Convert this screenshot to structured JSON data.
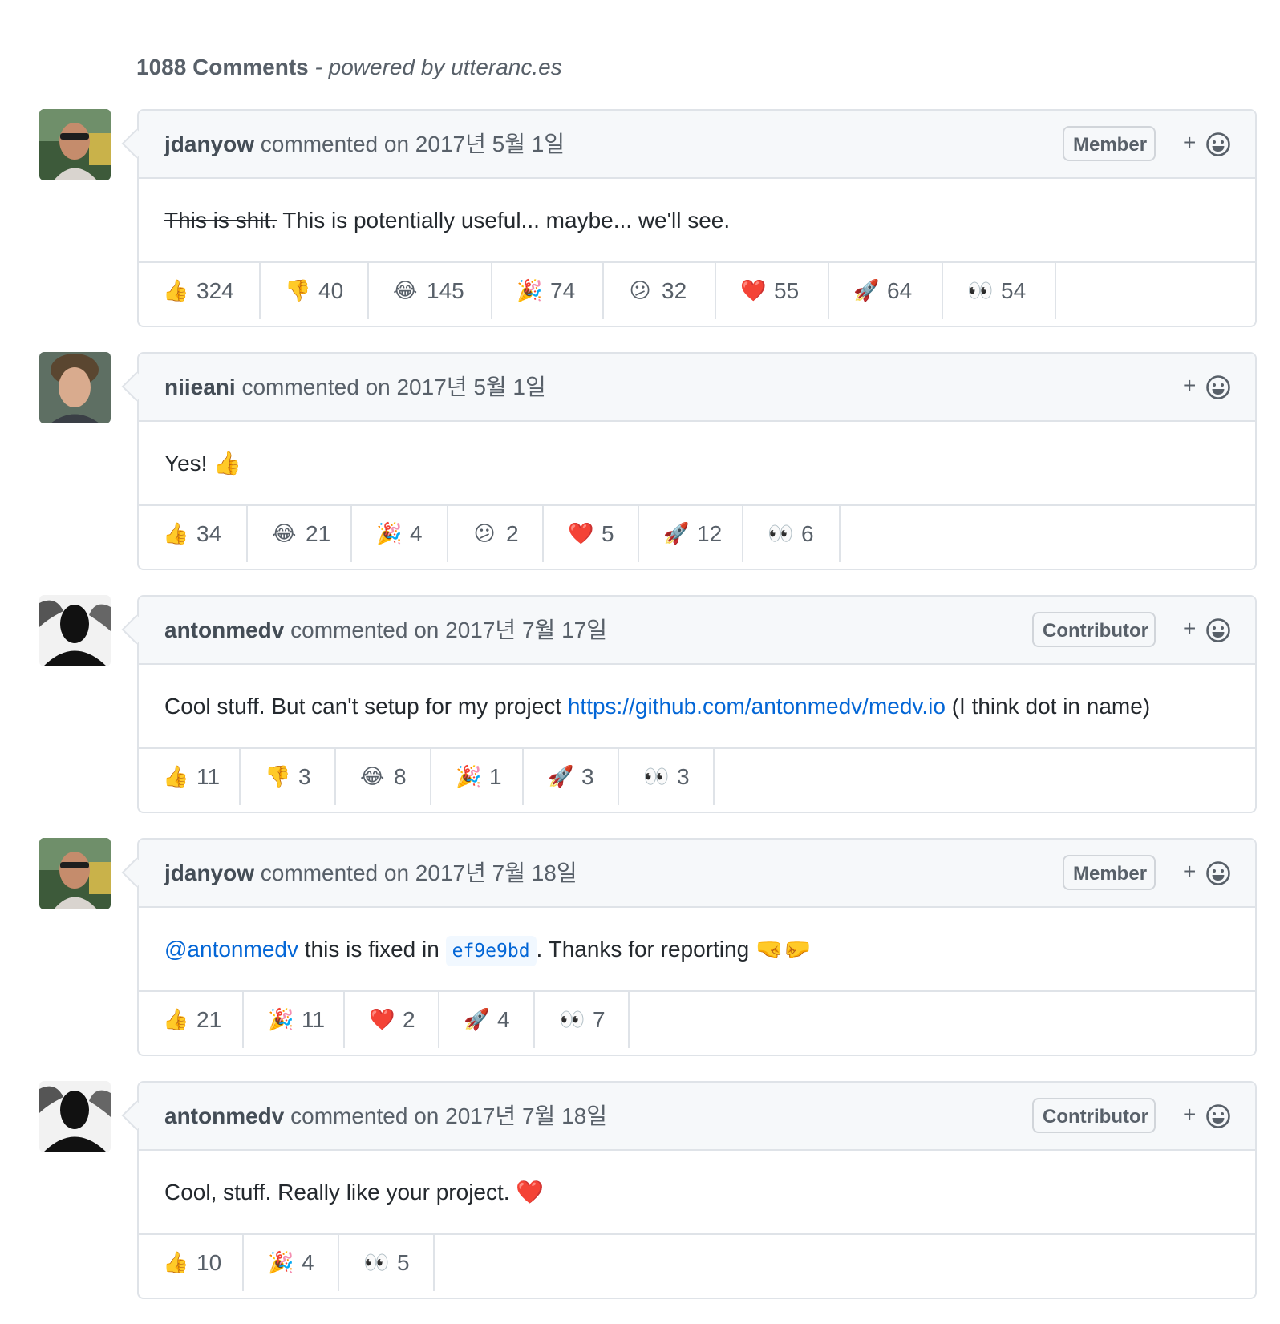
{
  "header": {
    "count_label": "1088 Comments",
    "powered_label": " - powered by utteranc.es"
  },
  "comments": [
    {
      "author": "jdanyow",
      "commented_label": "commented",
      "date_label": "on 2017년 5월 1일",
      "role": "Member",
      "avatar_icon": "avatar-jdanyow",
      "body": {
        "strike": "This is shit.",
        "text": " This is potentially useful... maybe... we'll see."
      },
      "reactions": [
        {
          "icon": "thumbs-up-icon",
          "glyph": "👍",
          "count": "324"
        },
        {
          "icon": "thumbs-down-icon",
          "glyph": "👎",
          "count": "40"
        },
        {
          "icon": "laugh-icon",
          "glyph": "😂",
          "count": "145"
        },
        {
          "icon": "hooray-icon",
          "glyph": "🎉",
          "count": "74"
        },
        {
          "icon": "confused-icon",
          "glyph": "😕",
          "count": "32"
        },
        {
          "icon": "heart-icon",
          "glyph": "❤️",
          "count": "55"
        },
        {
          "icon": "rocket-icon",
          "glyph": "🚀",
          "count": "64"
        },
        {
          "icon": "eyes-icon",
          "glyph": "👀",
          "count": "54"
        }
      ]
    },
    {
      "author": "niieani",
      "commented_label": "commented",
      "date_label": "on 2017년 5월 1일",
      "role": "",
      "avatar_icon": "avatar-niieani",
      "body": {
        "text": "Yes! 👍"
      },
      "reactions": [
        {
          "icon": "thumbs-up-icon",
          "glyph": "👍",
          "count": "34"
        },
        {
          "icon": "laugh-icon",
          "glyph": "😂",
          "count": "21"
        },
        {
          "icon": "hooray-icon",
          "glyph": "🎉",
          "count": "4"
        },
        {
          "icon": "confused-icon",
          "glyph": "😕",
          "count": "2"
        },
        {
          "icon": "heart-icon",
          "glyph": "❤️",
          "count": "5"
        },
        {
          "icon": "rocket-icon",
          "glyph": "🚀",
          "count": "12"
        },
        {
          "icon": "eyes-icon",
          "glyph": "👀",
          "count": "6"
        }
      ]
    },
    {
      "author": "antonmedv",
      "commented_label": "commented",
      "date_label": "on 2017년 7월 17일",
      "role": "Contributor",
      "avatar_icon": "avatar-antonmedv",
      "body": {
        "text": "Cool stuff. But can't setup for my project ",
        "link": "https://github.com/antonmedv/medv.io",
        "after": " (I think dot in name)"
      },
      "reactions": [
        {
          "icon": "thumbs-up-icon",
          "glyph": "👍",
          "count": "11"
        },
        {
          "icon": "thumbs-down-icon",
          "glyph": "👎",
          "count": "3"
        },
        {
          "icon": "laugh-icon",
          "glyph": "😂",
          "count": "8"
        },
        {
          "icon": "hooray-icon",
          "glyph": "🎉",
          "count": "1"
        },
        {
          "icon": "rocket-icon",
          "glyph": "🚀",
          "count": "3"
        },
        {
          "icon": "eyes-icon",
          "glyph": "👀",
          "count": "3"
        }
      ]
    },
    {
      "author": "jdanyow",
      "commented_label": "commented",
      "date_label": "on 2017년 7월 18일",
      "role": "Member",
      "avatar_icon": "avatar-jdanyow",
      "body": {
        "mention": "@antonmedv",
        "text": " this is fixed in ",
        "code": "ef9e9bd",
        "after": ". Thanks for reporting 🤜🤛"
      },
      "reactions": [
        {
          "icon": "thumbs-up-icon",
          "glyph": "👍",
          "count": "21"
        },
        {
          "icon": "hooray-icon",
          "glyph": "🎉",
          "count": "11"
        },
        {
          "icon": "heart-icon",
          "glyph": "❤️",
          "count": "2"
        },
        {
          "icon": "rocket-icon",
          "glyph": "🚀",
          "count": "4"
        },
        {
          "icon": "eyes-icon",
          "glyph": "👀",
          "count": "7"
        }
      ]
    },
    {
      "author": "antonmedv",
      "commented_label": "commented",
      "date_label": "on 2017년 7월 18일",
      "role": "Contributor",
      "avatar_icon": "avatar-antonmedv",
      "body": {
        "text": "Cool, stuff. Really like your project. ❤️"
      },
      "reactions": [
        {
          "icon": "thumbs-up-icon",
          "glyph": "👍",
          "count": "10"
        },
        {
          "icon": "hooray-icon",
          "glyph": "🎉",
          "count": "4"
        },
        {
          "icon": "eyes-icon",
          "glyph": "👀",
          "count": "5"
        }
      ]
    }
  ],
  "colors": {
    "link": "#0366d6",
    "header_bg": "#f6f8fa",
    "border": "#dfe3e8",
    "muted_text": "#586069"
  },
  "add_reaction": {
    "plus_label": "+",
    "icon": "smiley-icon"
  }
}
